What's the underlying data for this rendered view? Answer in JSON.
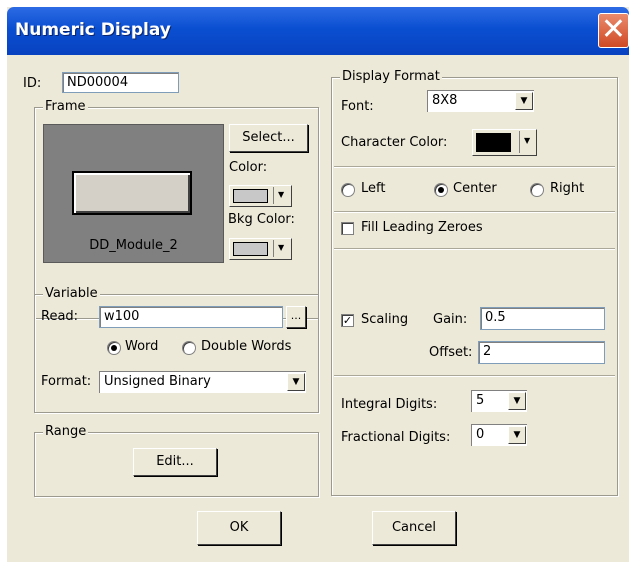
{
  "window": {
    "title": "Numeric Display",
    "close_glyph": "✕"
  },
  "id_field": {
    "label": "ID:",
    "value": "ND00004"
  },
  "frame": {
    "legend": "Frame",
    "select_label": "Select...",
    "color_label": "Color:",
    "bkg_color_label": "Bkg Color:",
    "preview_name": "DD_Module_2",
    "color_value": "#c8c8c8",
    "bkg_color_value": "#c8c8c8"
  },
  "variable": {
    "legend": "Variable",
    "read_label": "Read:",
    "read_value": "w100",
    "browse_label": "...",
    "word_label": "Word",
    "double_words_label": "Double Words",
    "format_label": "Format:",
    "format_value": "Unsigned Binary"
  },
  "range": {
    "legend": "Range",
    "edit_label": "Edit..."
  },
  "display_format": {
    "legend": "Display Format",
    "font_label": "Font:",
    "font_value": "8X8",
    "char_color_label": "Character Color:",
    "char_color_value": "#000000",
    "left_label": "Left",
    "center_label": "Center",
    "right_label": "Right",
    "fill_zeroes_label": "Fill Leading Zeroes",
    "scaling_label": "Scaling",
    "gain_label": "Gain:",
    "gain_value": "0.5",
    "offset_label": "Offset:",
    "offset_value": "2",
    "integral_label": "Integral Digits:",
    "integral_value": "5",
    "fractional_label": "Fractional Digits:",
    "fractional_value": "0"
  },
  "buttons": {
    "ok": "OK",
    "cancel": "Cancel"
  },
  "icons": {
    "dropdown": "chevron-down-icon",
    "check": "checkmark-icon",
    "close": "close-icon"
  },
  "glyphs": {
    "arrow": "▼",
    "check": "✓"
  }
}
